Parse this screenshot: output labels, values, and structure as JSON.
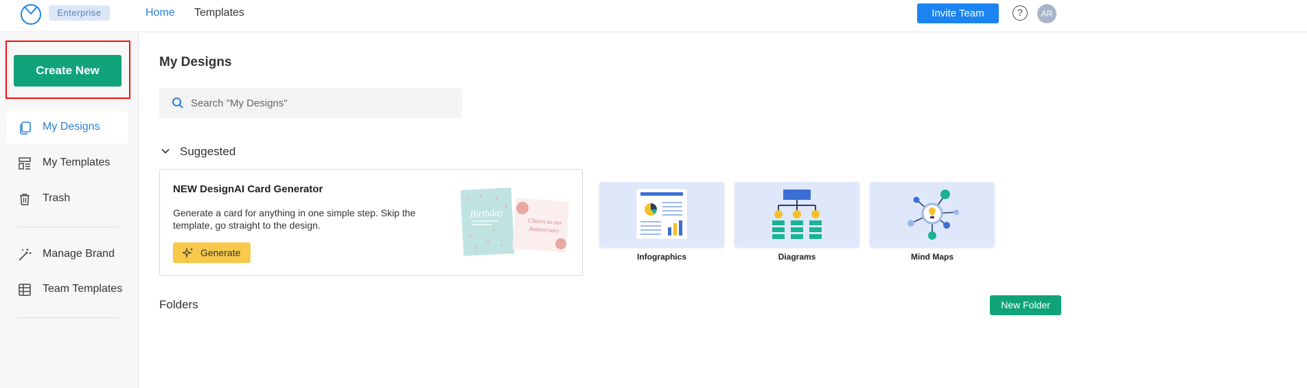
{
  "header": {
    "badge": "Enterprise",
    "nav": [
      {
        "label": "Home"
      },
      {
        "label": "Templates"
      }
    ],
    "invite_label": "Invite Team",
    "help": "?",
    "avatar_initials": "AR",
    "accent_color": "#1b84f0"
  },
  "sidebar": {
    "create_label": "Create New",
    "items": [
      {
        "label": "My Designs",
        "icon": "copy-icon"
      },
      {
        "label": "My Templates",
        "icon": "template-icon"
      },
      {
        "label": "Trash",
        "icon": "trash-icon"
      },
      {
        "label": "Manage Brand",
        "icon": "magic-wand-icon"
      },
      {
        "label": "Team Templates",
        "icon": "grid-table-icon"
      }
    ],
    "create_color": "#10a37a"
  },
  "main": {
    "title": "My Designs",
    "search": {
      "placeholder": "Search \"My Designs\"",
      "value": ""
    },
    "suggested": {
      "label": "Suggested",
      "card": {
        "title": "NEW DesignAI Card Generator",
        "description": "Generate a card for anything in one simple step. Skip the template, go straight to the design.",
        "button_label": "Generate"
      },
      "tiles": [
        {
          "label": "Infographics"
        },
        {
          "label": "Diagrams"
        },
        {
          "label": "Mind Maps"
        }
      ]
    },
    "folders_label": "Folders",
    "new_folder_label": "New Folder"
  }
}
